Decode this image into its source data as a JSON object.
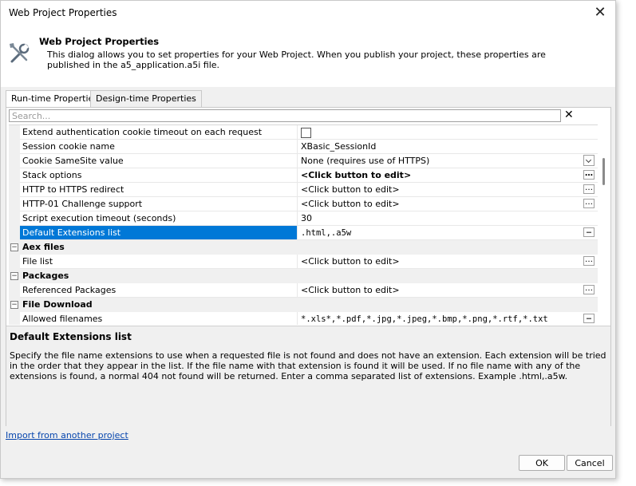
{
  "window": {
    "title": "Web Project Properties"
  },
  "header": {
    "title": "Web Project Properties",
    "description": "This dialog allows you to set properties for your Web Project. When you publish your project, these properties are published in the a5_application.a5i file."
  },
  "tabs": [
    {
      "label": "Run-time Properties",
      "active": true
    },
    {
      "label": "Design-time Properties",
      "active": false
    }
  ],
  "search": {
    "placeholder": "Search..."
  },
  "grid": {
    "rows": [
      {
        "kind": "prop",
        "name": "Extend authentication cookie timeout on each request",
        "value": "",
        "editor": "checkbox"
      },
      {
        "kind": "prop",
        "name": "Session cookie name",
        "value": "XBasic_SessionId",
        "editor": "none"
      },
      {
        "kind": "prop",
        "name": "Cookie SameSite value",
        "value": "None (requires use of HTTPS)",
        "editor": "dropdown"
      },
      {
        "kind": "prop",
        "name": "Stack options",
        "value": "<Click button to edit>",
        "editor": "ellipsis",
        "bold": true
      },
      {
        "kind": "prop",
        "name": "HTTP to HTTPS redirect",
        "value": "<Click button to edit>",
        "editor": "ellipsis"
      },
      {
        "kind": "prop",
        "name": "HTTP-01 Challenge support",
        "value": "<Click button to edit>",
        "editor": "ellipsis"
      },
      {
        "kind": "prop",
        "name": "Script execution timeout (seconds)",
        "value": "30",
        "editor": "none"
      },
      {
        "kind": "prop",
        "name": "Default Extensions list",
        "value": ".html,.a5w",
        "editor": "ellipsis",
        "selected": true,
        "mono": true
      },
      {
        "kind": "category",
        "name": "Aex files",
        "toggle": "−"
      },
      {
        "kind": "prop",
        "name": "File list",
        "value": "<Click button to edit>",
        "editor": "ellipsis"
      },
      {
        "kind": "category",
        "name": "Packages",
        "toggle": "−"
      },
      {
        "kind": "prop",
        "name": "Referenced Packages",
        "value": "<Click button to edit>",
        "editor": "ellipsis"
      },
      {
        "kind": "category",
        "name": "File Download",
        "toggle": "−"
      },
      {
        "kind": "prop",
        "name": "Allowed filenames",
        "value": "*.xls*,*.pdf,*.jpg,*.jpeg,*.bmp,*.png,*.rtf,*.txt",
        "editor": "ellipsis",
        "mono": true
      }
    ]
  },
  "description_panel": {
    "title": "Default Extensions list",
    "text": "Specify the file name extensions to use when a requested file is not found and does not have an extension. Each extension will be tried in the order that they appear in the list. If the file name with that extension is found it will be used. If no file name with any of the extensions is found, a normal 404 not found will be returned. Enter a comma separated list of extensions. Example .html,.a5w."
  },
  "footer": {
    "import_link": "Import from another project",
    "ok_label": "OK",
    "cancel_label": "Cancel"
  },
  "colors": {
    "selection": "#0078d7",
    "link": "#0645ad"
  },
  "icons": {
    "header_icon": "tools-icon",
    "close": "close-icon",
    "search_clear": "clear-icon"
  }
}
